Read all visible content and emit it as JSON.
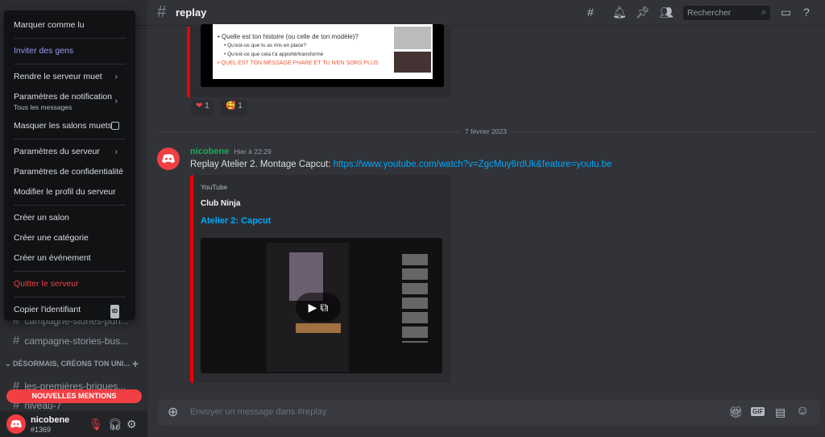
{
  "sidebar": {
    "channels": [
      "campagne-stories-pun...",
      "campagne-stories-bus...",
      "les-premières-briques...",
      "niveau-7"
    ],
    "category": "DÉSORMAIS, CRÉONS TON UNI...",
    "mentions": "NOUVELLES MENTIONS",
    "user": {
      "name": "nicobene",
      "tag": "#1369"
    }
  },
  "menu": {
    "items": [
      {
        "label": "Marquer comme lu"
      },
      {
        "label": "Inviter des gens"
      },
      {
        "label": "Rendre le serveur muet"
      },
      {
        "label": "Paramètres de notification",
        "sub": "Tous les messages"
      },
      {
        "label": "Masquer les salons muets"
      },
      {
        "label": "Paramètres du serveur"
      },
      {
        "label": "Paramètres de confidentialité"
      },
      {
        "label": "Modifier le profil du serveur"
      },
      {
        "label": "Créer un salon"
      },
      {
        "label": "Créer une catégorie"
      },
      {
        "label": "Créer un événement"
      },
      {
        "label": "Quitter le serveur"
      },
      {
        "label": "Copier l'identifiant",
        "badge": "ID"
      }
    ]
  },
  "header": {
    "channel": "replay",
    "search_placeholder": "Rechercher"
  },
  "slide": {
    "lines": [
      "• Quelle est ton histoire (ou celle de ton modèle)?",
      "• Qu'est-ce que tu as mis en place?",
      "• Qu'est-ce que cela t'a apporté/transformé",
      "• QUEL EST TON MESSAGE PHARE ET TU N'EN SORS PLUS"
    ]
  },
  "reactions": [
    {
      "emoji": "❤",
      "count": "1"
    },
    {
      "emoji": "🥰",
      "count": "1"
    }
  ],
  "date_divider": "7 février 2023",
  "message": {
    "author": "nicobene",
    "time": "Hier à 22:29",
    "text": "Replay Atelier 2. Montage Capcut: ",
    "link": "https://www.youtube.com/watch?v=ZgcMuy6rdUk&feature=youtu.be",
    "embed": {
      "provider": "YouTube",
      "author": "Club Ninja",
      "title": "Atelier 2: Capcut"
    }
  },
  "input": {
    "placeholder": "Envoyer un message dans #replay",
    "gif": "GIF"
  },
  "colors": {
    "accent": "#f23f43",
    "link": "#00a8fc",
    "author": "#23a55a"
  }
}
